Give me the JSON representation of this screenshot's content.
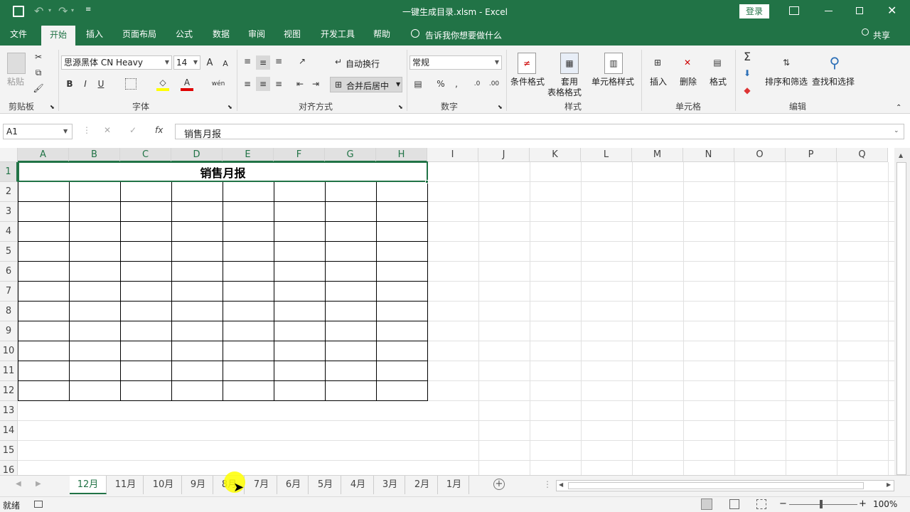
{
  "window": {
    "title": "一键生成目录.xlsm  -  Excel",
    "login_label": "登录"
  },
  "ribbon_tabs": [
    "文件",
    "开始",
    "插入",
    "页面布局",
    "公式",
    "数据",
    "审阅",
    "视图",
    "开发工具",
    "帮助"
  ],
  "tell_me": "告诉我你想要做什么",
  "share_label": "共享",
  "ribbon": {
    "clipboard": {
      "paste_label": "粘贴",
      "group_label": "剪贴板"
    },
    "font": {
      "font_name": "思源黑体 CN Heavy",
      "font_size": "14",
      "group_label": "字体"
    },
    "alignment": {
      "wrap_text": "自动换行",
      "merge_center": "合并后居中",
      "group_label": "对齐方式"
    },
    "number": {
      "format": "常规",
      "group_label": "数字"
    },
    "styles": {
      "conditional": "条件格式",
      "table_format_1": "套用",
      "table_format_2": "表格格式",
      "cell_styles": "单元格样式",
      "group_label": "样式"
    },
    "cells": {
      "insert": "插入",
      "delete": "删除",
      "format": "格式",
      "group_label": "单元格"
    },
    "editing": {
      "sort_filter": "排序和筛选",
      "find_select": "查找和选择",
      "group_label": "编辑"
    }
  },
  "formula_bar": {
    "name_box": "A1",
    "fx": "fx",
    "content": "销售月报"
  },
  "columns": [
    "A",
    "B",
    "C",
    "D",
    "E",
    "F",
    "G",
    "H",
    "I",
    "J",
    "K",
    "L",
    "M",
    "N",
    "O",
    "P",
    "Q"
  ],
  "rows": [
    "1",
    "2",
    "3",
    "4",
    "5",
    "6",
    "7",
    "8",
    "9",
    "10",
    "11",
    "12",
    "13",
    "14",
    "15",
    "16"
  ],
  "cells": {
    "A1": "销售月报"
  },
  "sheet_tabs": [
    "12月",
    "11月",
    "10月",
    "9月",
    "8月",
    "7月",
    "6月",
    "5月",
    "4月",
    "3月",
    "2月",
    "1月"
  ],
  "active_sheet": "12月",
  "status": {
    "ready": "就绪",
    "zoom": "100%"
  },
  "colors": {
    "excel_green": "#217346",
    "cursor_highlight": "#ffff00"
  }
}
